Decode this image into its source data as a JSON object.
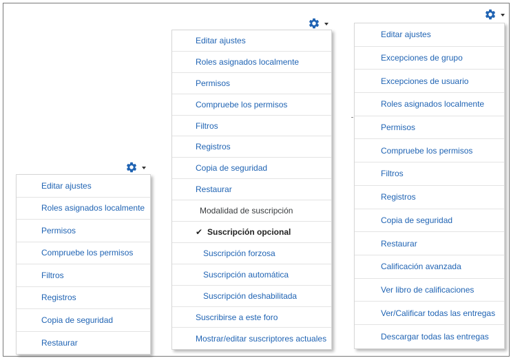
{
  "accent_color": "#1f63b3",
  "icons": {
    "settings": "gear-icon",
    "dropdown": "caret-down-icon",
    "selected": "checkmark-icon"
  },
  "menu_left": {
    "items": [
      "Editar ajustes",
      "Roles asignados localmente",
      "Permisos",
      "Compruebe los permisos",
      "Filtros",
      "Registros",
      "Copia de seguridad",
      "Restaurar"
    ]
  },
  "menu_middle": {
    "items": [
      "Editar ajustes",
      "Roles asignados localmente",
      "Permisos",
      "Compruebe los permisos",
      "Filtros",
      "Registros",
      "Copia de seguridad",
      "Restaurar"
    ],
    "subscription_header": "Modalidad de suscripción",
    "subscription_selected": "Suscripción opcional",
    "subscription_options": [
      "Suscripción forzosa",
      "Suscripción automática",
      "Suscripción deshabilitada"
    ],
    "subscribe_link": "Suscribirse a este foro",
    "show_subscribers": "Mostrar/editar suscriptores actuales"
  },
  "menu_right": {
    "items": [
      "Editar ajustes",
      "Excepciones de grupo",
      "Excepciones de usuario",
      "Roles asignados localmente",
      "Permisos",
      "Compruebe los permisos",
      "Filtros",
      "Registros",
      "Copia de seguridad",
      "Restaurar",
      "Calificación avanzada",
      "Ver libro de calificaciones",
      "Ver/Calificar todas las entregas",
      "Descargar todas las entregas"
    ]
  }
}
